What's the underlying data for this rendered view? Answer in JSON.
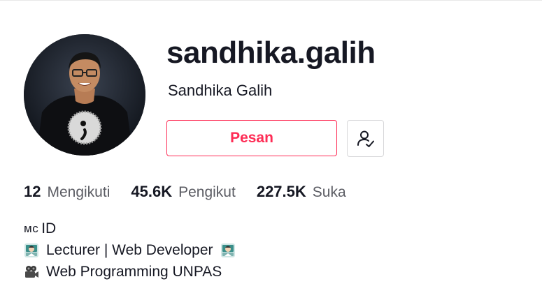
{
  "profile": {
    "username": "sandhika.galih",
    "display_name": "Sandhika Galih",
    "avatar_icon": "profile-photo"
  },
  "actions": {
    "message_label": "Pesan",
    "follow_icon": "user-check-icon",
    "accent_color": "#fe2c55"
  },
  "stats": [
    {
      "number": "12",
      "label": "Mengikuti"
    },
    {
      "number": "45.6K",
      "label": "Pengikut"
    },
    {
      "number": "227.5K",
      "label": "Suka"
    }
  ],
  "bio": {
    "line1_prefix": "ᴍᴄ",
    "line1_text": "ID",
    "line2_text": "Lecturer | Web Developer",
    "line2_icon": "technologist-emoji",
    "line3_text": "Web Programming UNPAS",
    "line3_icon": "movie-camera-emoji"
  }
}
